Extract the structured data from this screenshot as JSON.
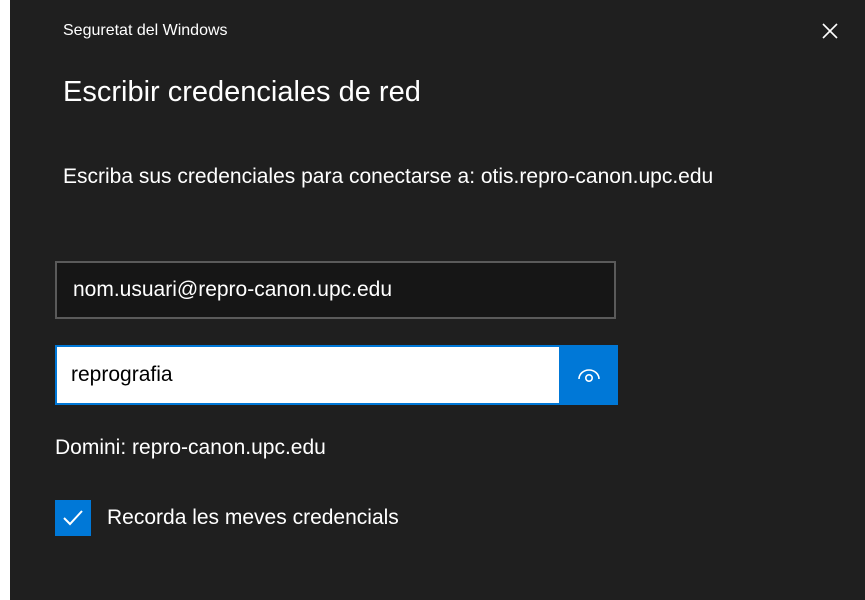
{
  "window": {
    "app_title": "Seguretat del Windows",
    "close_icon": "close-icon"
  },
  "dialog": {
    "heading": "Escribir credenciales de red",
    "prompt": "Escriba sus credenciales para conectarse a: otis.repro-canon.upc.edu",
    "username_value": "nom.usuari@repro-canon.upc.edu",
    "password_value": "reprografia",
    "reveal_icon": "eye-reveal-icon",
    "domain": "Domini: repro-canon.upc.edu",
    "remember_label": "Recorda les meves credencials",
    "remember_checked": true,
    "checkmark_icon": "checkmark-icon"
  },
  "colors": {
    "accent": "#0078d7",
    "background": "#1f1f1f",
    "text": "#ffffff"
  }
}
